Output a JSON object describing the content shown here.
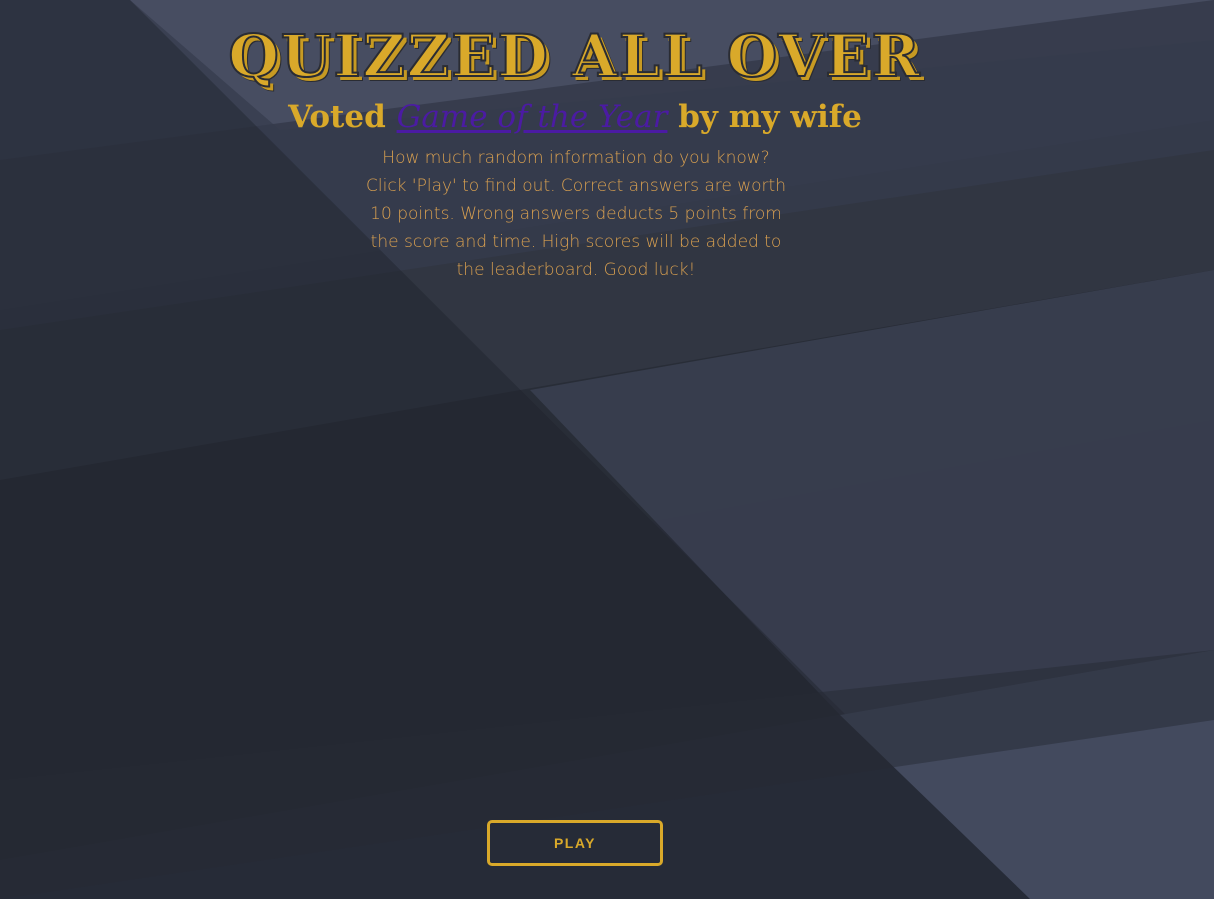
{
  "header": {
    "title": "QUIZZED ALL OVER",
    "subtitle_prefix": "Voted ",
    "subtitle_link": "Game of the Year",
    "subtitle_suffix": " by my wife"
  },
  "intro": {
    "description": "How much random information do you know? Click 'Play' to find out. Correct answers are worth 10 points. Wrong answers deducts 5 points from the score and time. High scores will be added to the leaderboard. Good luck!"
  },
  "actions": {
    "play_label": "PLAY"
  },
  "colors": {
    "accent": "#d9a92a",
    "link": "#4b1ba3",
    "text": "#d9a050",
    "background": "#2b303d"
  }
}
